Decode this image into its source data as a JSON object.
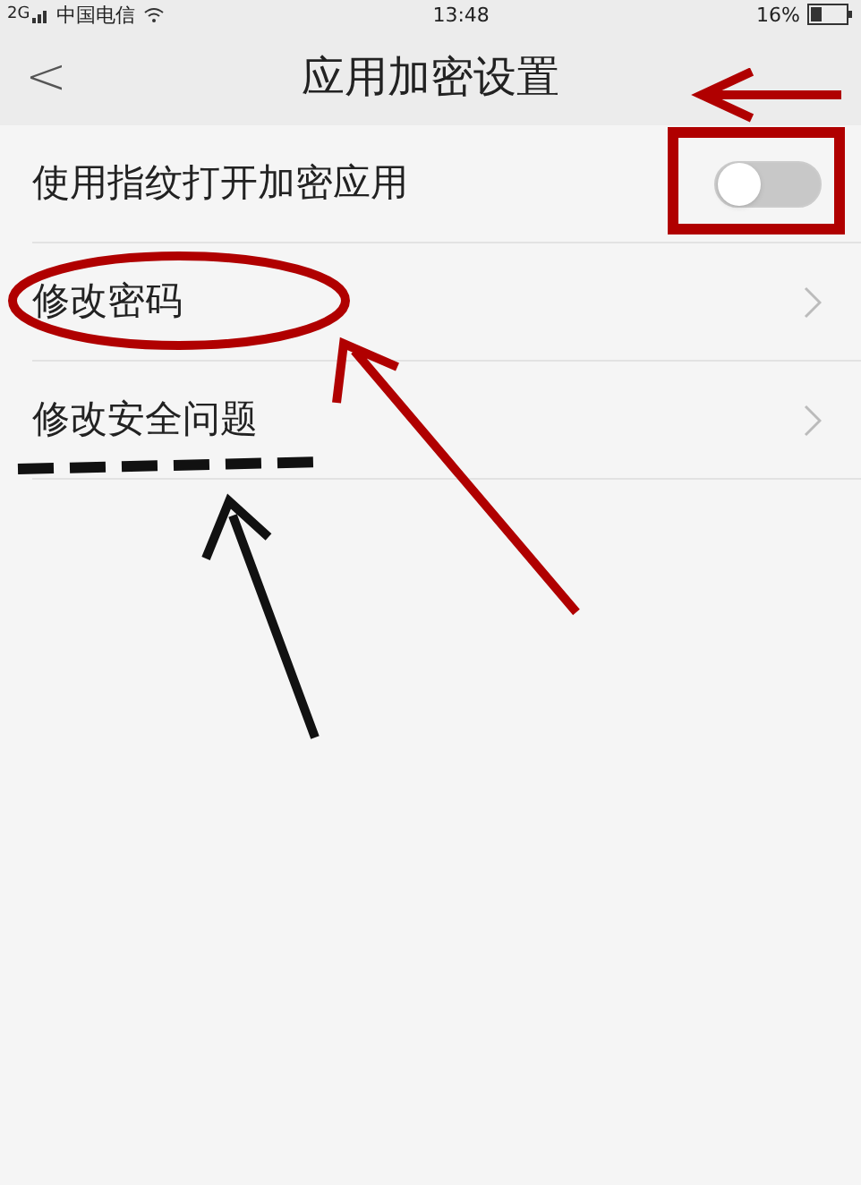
{
  "status_bar": {
    "network": "2G",
    "carrier": "中国电信",
    "time": "13:48",
    "battery": "16%"
  },
  "header": {
    "back": "<",
    "title": "应用加密设置"
  },
  "rows": [
    {
      "kind": "toggle",
      "label": "使用指纹打开加密应用",
      "on": false
    },
    {
      "kind": "link",
      "label": "修改密码"
    },
    {
      "kind": "link",
      "label": "修改安全问题"
    }
  ]
}
